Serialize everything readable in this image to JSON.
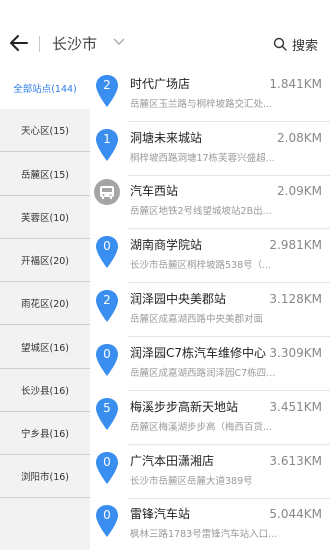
{
  "header": {
    "city": "长沙市",
    "search_label": "搜索"
  },
  "sidebar": {
    "items": [
      {
        "label": "全部站点(144)"
      },
      {
        "label": "天心区(15)"
      },
      {
        "label": "岳麓区(15)"
      },
      {
        "label": "芙蓉区(10)"
      },
      {
        "label": "开福区(20)"
      },
      {
        "label": "雨花区(20)"
      },
      {
        "label": "望城区(16)"
      },
      {
        "label": "长沙县(16)"
      },
      {
        "label": "宁乡县(16)"
      },
      {
        "label": "浏阳市(16)"
      }
    ]
  },
  "stations": [
    {
      "count": "2",
      "name": "时代广场店",
      "distance": "1.841KM",
      "address": "岳麓区玉兰路与桐梓坡路交汇处..."
    },
    {
      "count": "1",
      "name": "洞塘未来城站",
      "distance": "2.08KM",
      "address": "桐梓坡西路洞塘17栋芙蓉兴盛超..."
    },
    {
      "count": "",
      "name": "汽车西站",
      "distance": "2.09KM",
      "address": "岳麓区地铁2号线望城坡站2B出..."
    },
    {
      "count": "0",
      "name": "湖南商学院站",
      "distance": "2.981KM",
      "address": "长沙市岳麓区桐梓坡路538号（..."
    },
    {
      "count": "2",
      "name": "润泽园中央美郡站",
      "distance": "3.128KM",
      "address": "岳麓区成嘉湖西路中央美郡对面"
    },
    {
      "count": "0",
      "name": "润泽园C7栋汽车维修中心",
      "distance": "3.309KM",
      "address": "岳麓区成嘉湖西路润泽园C7栋四..."
    },
    {
      "count": "5",
      "name": "梅溪步步高新天地站",
      "distance": "3.451KM",
      "address": "岳麓区梅溪湖步步高（梅西百货..."
    },
    {
      "count": "0",
      "name": "广汽本田潇湘店",
      "distance": "3.613KM",
      "address": "长沙市岳麓区岳麓大道389号"
    },
    {
      "count": "0",
      "name": "雷锋汽车站",
      "distance": "5.044KM",
      "address": "枫林三路1783号雷锋汽车站入口..."
    }
  ],
  "colors": {
    "accent": "#2e7ee8",
    "pin": "#3a8ef0",
    "sidebar_bg": "#f2f2f2"
  }
}
